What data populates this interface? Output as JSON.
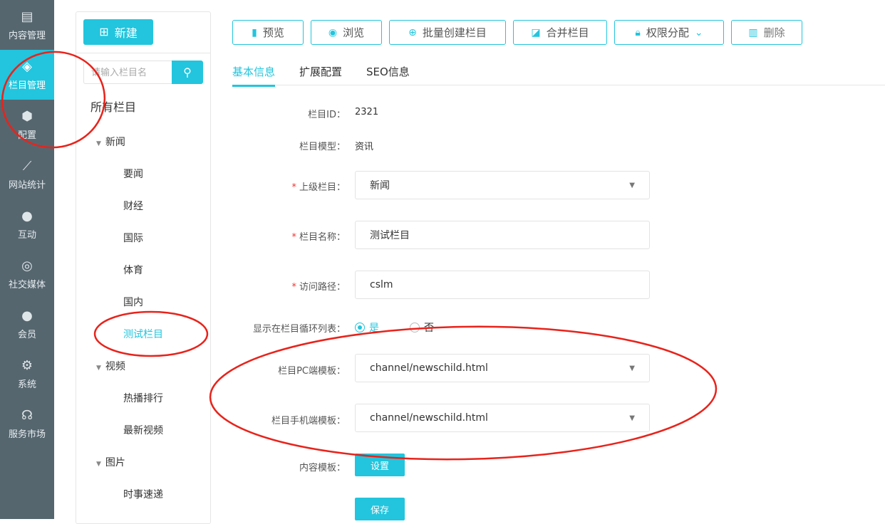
{
  "sidebar": {
    "items": [
      {
        "label": "内容管理",
        "icon": "document-icon"
      },
      {
        "label": "栏目管理",
        "icon": "layers-icon"
      },
      {
        "label": "配置",
        "icon": "cube-icon"
      },
      {
        "label": "网站统计",
        "icon": "chart-line-icon"
      },
      {
        "label": "互动",
        "icon": "chat-icon"
      },
      {
        "label": "社交媒体",
        "icon": "social-icon"
      },
      {
        "label": "会员",
        "icon": "user-icon"
      },
      {
        "label": "系统",
        "icon": "gear-icon"
      },
      {
        "label": "服务市场",
        "icon": "headset-icon"
      }
    ]
  },
  "tree": {
    "new_label": "新建",
    "search_placeholder": "请输入栏目名",
    "all_label": "所有栏目",
    "groups": [
      {
        "label": "新闻",
        "children": [
          "要闻",
          "财经",
          "国际",
          "体育",
          "国内",
          "测试栏目"
        ]
      },
      {
        "label": "视频",
        "children": [
          "热播排行",
          "最新视频"
        ]
      },
      {
        "label": "图片",
        "children": [
          "时事速递"
        ]
      }
    ],
    "selected": "测试栏目"
  },
  "toolbar": {
    "preview": "预览",
    "browse": "浏览",
    "batch_create": "批量创建栏目",
    "merge": "合并栏目",
    "permissions": "权限分配",
    "delete": "删除"
  },
  "tabs": [
    "基本信息",
    "扩展配置",
    "SEO信息"
  ],
  "form": {
    "id_label": "栏目ID：",
    "id_value": "2321",
    "model_label": "栏目模型：",
    "model_value": "资讯",
    "parent_label": "上级栏目：",
    "parent_value": "新闻",
    "name_label": "栏目名称：",
    "name_value": "测试栏目",
    "path_label": "访问路径：",
    "path_value": "cslm",
    "show_label": "显示在栏目循环列表：",
    "show_yes": "是",
    "show_no": "否",
    "pc_tpl_label": "栏目PC端模板：",
    "pc_tpl_value": "channel/newschild.html",
    "mobile_tpl_label": "栏目手机端模板：",
    "mobile_tpl_value": "channel/newschild.html",
    "content_tpl_label": "内容模板：",
    "content_tpl_button": "设置",
    "save_button": "保存"
  },
  "colors": {
    "accent": "#22c5dd",
    "sidebar": "#56666f",
    "annotation": "#e8231b"
  }
}
